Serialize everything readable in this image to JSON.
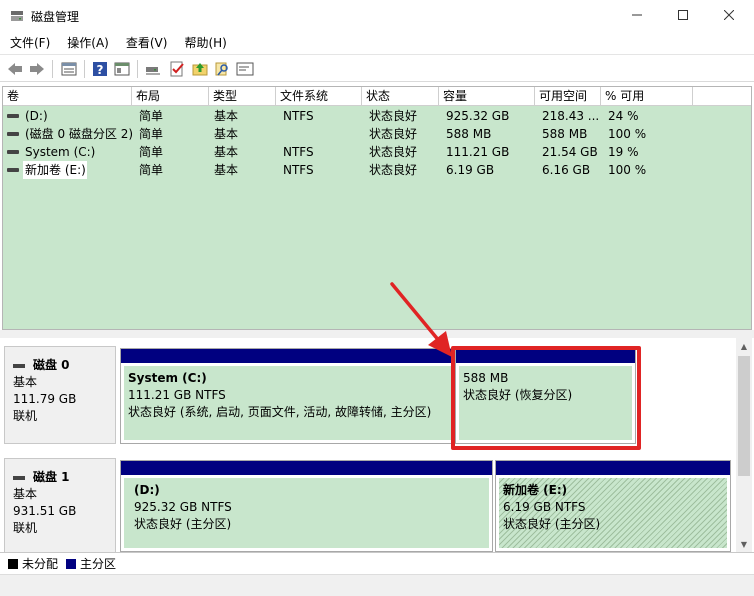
{
  "window": {
    "title": "磁盘管理",
    "controls": {
      "minimize": "—",
      "maximize": "☐",
      "close": "✕"
    }
  },
  "menu": [
    "文件(F)",
    "操作(A)",
    "查看(V)",
    "帮助(H)"
  ],
  "toolbar": {
    "icons": [
      "back-arrow-icon",
      "forward-arrow-icon",
      "list-view-icon",
      "help-icon",
      "properties-icon",
      "connect-icon",
      "check-icon",
      "folder-up-icon",
      "search-icon",
      "console-icon"
    ]
  },
  "volume_table": {
    "columns": [
      "卷",
      "布局",
      "类型",
      "文件系统",
      "状态",
      "容量",
      "可用空间",
      "% 可用"
    ],
    "rows": [
      {
        "volume": "(D:)",
        "layout": "简单",
        "type": "基本",
        "fs": "NTFS",
        "status": "状态良好",
        "capacity": "925.32 GB",
        "free": "218.43 ...",
        "pct": "24 %"
      },
      {
        "volume": "(磁盘 0 磁盘分区 2)",
        "layout": "简单",
        "type": "基本",
        "fs": "",
        "status": "状态良好",
        "capacity": "588 MB",
        "free": "588 MB",
        "pct": "100 %"
      },
      {
        "volume": "System (C:)",
        "layout": "简单",
        "type": "基本",
        "fs": "NTFS",
        "status": "状态良好",
        "capacity": "111.21 GB",
        "free": "21.54 GB",
        "pct": "19 %"
      },
      {
        "volume": "新加卷 (E:)",
        "layout": "简单",
        "type": "基本",
        "fs": "NTFS",
        "status": "状态良好",
        "capacity": "6.19 GB",
        "free": "6.16 GB",
        "pct": "100 %"
      }
    ]
  },
  "disks": [
    {
      "name": "磁盘 0",
      "kind": "基本",
      "size": "111.79 GB",
      "state": "联机",
      "partitions": [
        {
          "title": "System  (C:)",
          "size": "111.21 GB NTFS",
          "status": "状态良好 (系统, 启动, 页面文件, 活动, 故障转储, 主分区)"
        },
        {
          "title": "",
          "size": "588 MB",
          "status": "状态良好 (恢复分区)"
        }
      ]
    },
    {
      "name": "磁盘 1",
      "kind": "基本",
      "size": "931.51 GB",
      "state": "联机",
      "partitions": [
        {
          "title": "(D:)",
          "size": "925.32 GB NTFS",
          "status": "状态良好 (主分区)"
        },
        {
          "title": "新加卷  (E:)",
          "size": "6.19 GB NTFS",
          "status": "状态良好 (主分区)"
        }
      ]
    }
  ],
  "legend": [
    {
      "label": "未分配",
      "color": "#000000"
    },
    {
      "label": "主分区",
      "color": "#000080"
    }
  ],
  "colors": {
    "primary_partition": "#000080",
    "volume_bg": "#c8e6cc",
    "highlight": "#e02424"
  }
}
